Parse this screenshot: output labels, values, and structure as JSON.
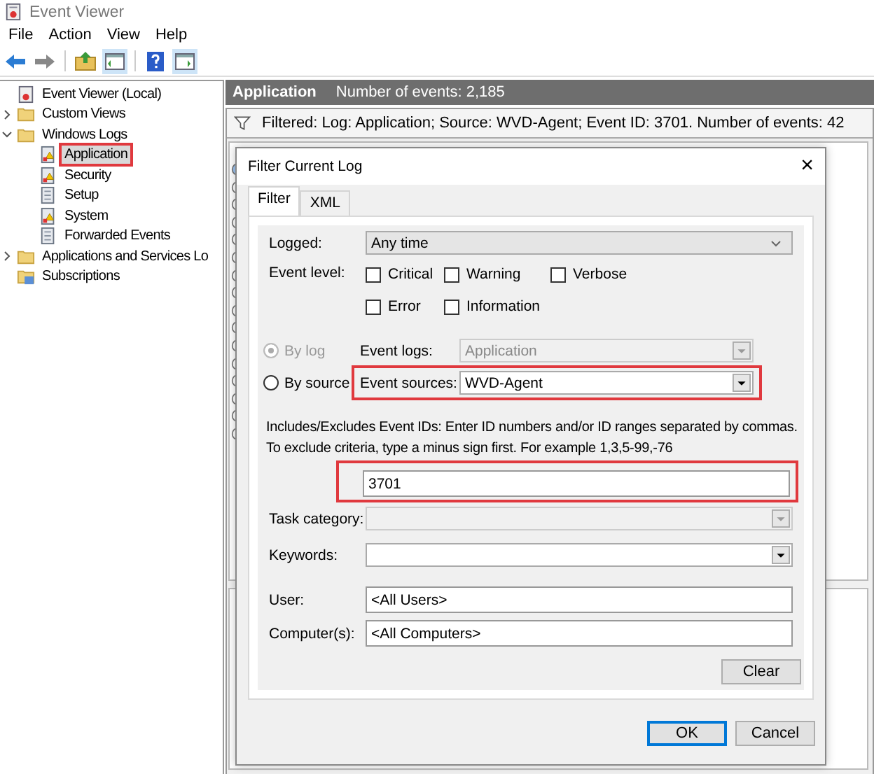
{
  "window": {
    "title": "Event Viewer"
  },
  "menu": [
    "File",
    "Action",
    "View",
    "Help"
  ],
  "tree": [
    {
      "label": "Event Viewer (Local)",
      "selected": false,
      "children": [
        {
          "label": "Custom Views",
          "kind": "folder",
          "expanded": false,
          "selected": false,
          "highlighted": false
        },
        {
          "label": "Windows Logs",
          "kind": "folder",
          "expanded": true,
          "selected": false,
          "highlighted": false,
          "children": [
            {
              "label": "Application",
              "kind": "warnlog",
              "selected": true,
              "highlighted": true
            },
            {
              "label": "Security",
              "kind": "warnlog",
              "selected": false,
              "highlighted": false
            },
            {
              "label": "Setup",
              "kind": "log",
              "selected": false,
              "highlighted": false
            },
            {
              "label": "System",
              "kind": "warnlog",
              "selected": false,
              "highlighted": false
            },
            {
              "label": "Forwarded Events",
              "kind": "log",
              "selected": false,
              "highlighted": false
            }
          ]
        },
        {
          "label": "Applications and Services Lo",
          "kind": "folder",
          "expanded": false,
          "selected": false,
          "highlighted": false
        },
        {
          "label": "Subscriptions",
          "kind": "subscriptions",
          "selected": false,
          "highlighted": false
        }
      ]
    }
  ],
  "log_header": {
    "title": "Application",
    "count": "Number of events: 2,185"
  },
  "filter_bar": "Filtered: Log: Application; Source: WVD-Agent; Event ID: 3701. Number of events: 42",
  "dialog": {
    "title": "Filter Current Log",
    "close": "×",
    "tabs": [
      {
        "label": "Filter",
        "selected": true
      },
      {
        "label": "XML",
        "selected": false
      }
    ],
    "logged": {
      "label": "Logged:",
      "value": "Any time"
    },
    "event_level": {
      "label": "Event level:",
      "levels": [
        {
          "label": "Critical",
          "checked": false
        },
        {
          "label": "Warning",
          "checked": false
        },
        {
          "label": "Verbose",
          "checked": false
        },
        {
          "label": "Error",
          "checked": false
        },
        {
          "label": "Information",
          "checked": false
        }
      ]
    },
    "scope": [
      {
        "radio": "By log",
        "selected": true,
        "disabled": true,
        "label": "Event logs:",
        "value": "Application",
        "highlighted": false
      },
      {
        "radio": "By source",
        "selected": false,
        "disabled": false,
        "label": "Event sources:",
        "value": "WVD-Agent",
        "highlighted": true
      }
    ],
    "ids_hint": "Includes/Excludes Event IDs: Enter ID numbers and/or ID ranges separated by commas. To exclude criteria, type a minus sign first. For example 1,3,5-99,-76",
    "event_ids": {
      "value": "3701",
      "highlighted": true
    },
    "task_category": {
      "label": "Task category:",
      "disabled": true
    },
    "keywords": {
      "label": "Keywords:",
      "disabled": false
    },
    "user": {
      "label": "User:",
      "value": "<All Users>"
    },
    "computers": {
      "label": "Computer(s):",
      "value": "<All Computers>"
    },
    "buttons": {
      "clear": "Clear",
      "ok": "OK",
      "cancel": "Cancel"
    }
  }
}
